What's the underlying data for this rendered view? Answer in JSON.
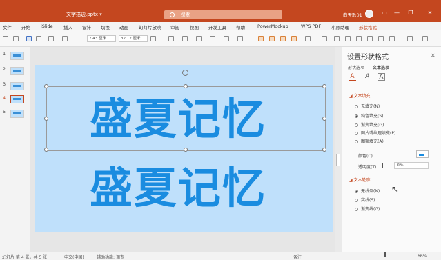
{
  "titlebar": {
    "filename": "文字描边.pptx ▾",
    "search_placeholder": "搜索",
    "user": "向天歌01",
    "minimize": "—",
    "restore": "❐",
    "close": "✕",
    "ribbon_display": "▭"
  },
  "menu": [
    {
      "label": "文件"
    },
    {
      "label": "开始"
    },
    {
      "label": "iSlide"
    },
    {
      "label": "插入"
    },
    {
      "label": "设计"
    },
    {
      "label": "切换"
    },
    {
      "label": "动画"
    },
    {
      "label": "幻灯片放映"
    },
    {
      "label": "审阅"
    },
    {
      "label": "视图"
    },
    {
      "label": "开发工具"
    },
    {
      "label": "帮助"
    },
    {
      "label": "PowerMockup"
    },
    {
      "label": "WPS PDF"
    },
    {
      "label": "小顾助理"
    },
    {
      "label": "形状格式"
    }
  ],
  "ribbon": {
    "width_value": "7.43 厘米",
    "height_value": "32.12 厘米"
  },
  "thumbnails": [
    {
      "num": "1"
    },
    {
      "num": "2"
    },
    {
      "num": "3"
    },
    {
      "num": "4"
    },
    {
      "num": "5"
    }
  ],
  "slide": {
    "text_line1": "盛夏记忆",
    "text_line2": "盛夏记忆",
    "text_color": "#1a8ce0",
    "background": "#bfe0fb"
  },
  "pane": {
    "title": "设置形状格式",
    "close": "✕",
    "tabs": [
      "形状选项",
      "文本选项"
    ],
    "icons": [
      {
        "glyph": "A",
        "icon": "text-fill-outline-icon"
      },
      {
        "glyph": "A",
        "icon": "text-effects-icon"
      },
      {
        "glyph": "A",
        "icon": "textbox-icon"
      }
    ],
    "text_fill": {
      "heading": "◢ 文本填充",
      "options": [
        "无填充(N)",
        "纯色填充(S)",
        "渐变填充(G)",
        "图片或纹理填充(P)",
        "图案填充(A)"
      ],
      "selected": 1,
      "color_label": "颜色(C)",
      "transparency_label": "透明度(T)",
      "transparency_value": "0%"
    },
    "text_outline": {
      "heading": "◢ 文本轮廓",
      "options": [
        "无线条(N)",
        "实线(S)",
        "渐变线(G)"
      ],
      "selected": 0
    }
  },
  "status": {
    "slide_info": "幻灯片 第 4 张，共 5 张",
    "language": "中文(中国)",
    "accessibility": "辅助功能: 调查",
    "notes": "备注",
    "zoom": "66%"
  }
}
